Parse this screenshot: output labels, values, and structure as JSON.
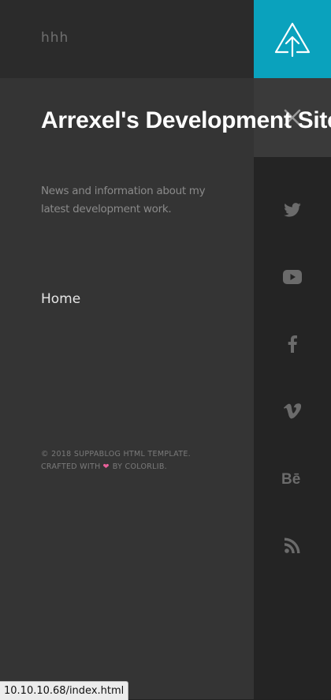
{
  "header": {
    "tagline": "hhh"
  },
  "site": {
    "title": "Arrexel's Development Site",
    "description": "News and information about my latest development work."
  },
  "nav": {
    "items": [
      {
        "label": "Home"
      }
    ]
  },
  "footer": {
    "line1": "© 2018 SUPPABLOG HTML TEMPLATE.",
    "crafted_prefix": "CRAFTED WITH",
    "crafted_suffix": "BY COLORLIB."
  },
  "social": [
    "twitter-icon",
    "youtube-icon",
    "facebook-icon",
    "vimeo-icon",
    "behance-icon",
    "rss-icon"
  ],
  "status_bar": {
    "url": "10.10.10.68/index.html"
  },
  "colors": {
    "accent": "#0aa2bd",
    "panel": "#343434",
    "sidebar": "#242424",
    "heart": "#e9609a"
  }
}
